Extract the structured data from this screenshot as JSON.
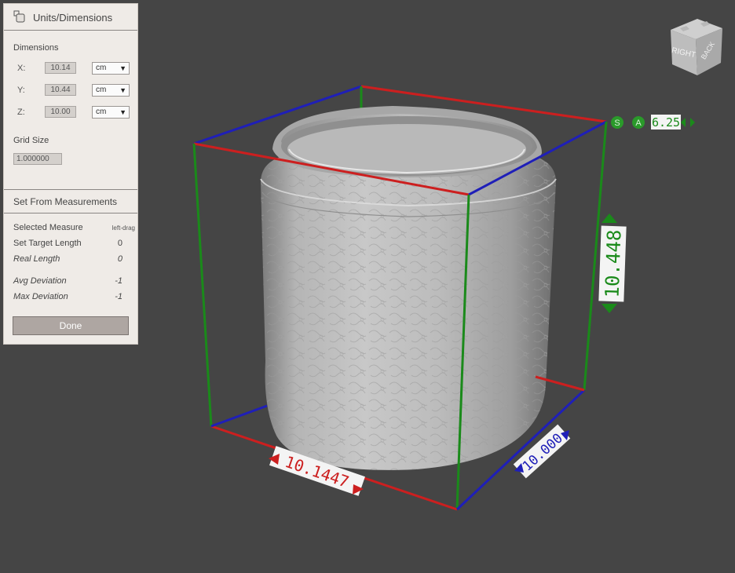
{
  "panel": {
    "title": "Units/Dimensions",
    "dimensions_label": "Dimensions",
    "x_label": "X:",
    "x_value": "10.14",
    "x_unit": "cm",
    "y_label": "Y:",
    "y_value": "10.44",
    "y_unit": "cm",
    "z_label": "Z:",
    "z_value": "10.00",
    "z_unit": "cm",
    "grid_size_label": "Grid Size",
    "grid_size_value": "1.000000",
    "set_from_measurements_label": "Set From Measurements",
    "selected_measure_label": "Selected Measure",
    "selected_measure_value": "left-drag",
    "set_target_length_label": "Set Target Length",
    "set_target_length_value": "0",
    "real_length_label": "Real Length",
    "real_length_value": "0",
    "avg_deviation_label": "Avg Deviation",
    "avg_deviation_value": "-1",
    "max_deviation_label": "Max Deviation",
    "max_deviation_value": "-1",
    "done_label": "Done"
  },
  "navcube": {
    "face_right": "RIGHT",
    "face_back": "BACK"
  },
  "viewport": {
    "scale_badge_s": "S",
    "scale_badge_a": "A",
    "scale_value": "6.25",
    "height_label": "10.448",
    "width_label": "10.1447",
    "depth_label": "10.000"
  },
  "colors": {
    "background": "#454545",
    "x_axis": "#cc1f1f",
    "y_axis": "#1a8a1a",
    "z_axis": "#1f1fb8",
    "panel": "#efebe7",
    "done_button": "#aea6a2"
  }
}
